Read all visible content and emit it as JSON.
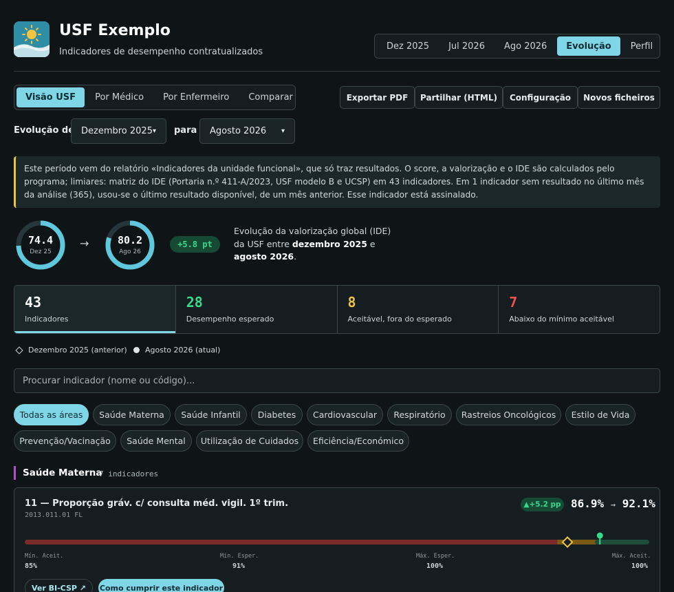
{
  "header": {
    "title": "USF Exemplo",
    "subtitle": "Indicadores de desempenho contratualizados",
    "logo_icon": "sun-landscape-icon",
    "period_tabs": [
      "Dez 2025",
      "Jul 2026",
      "Ago 2026",
      "Evolução",
      "Perfil"
    ],
    "active_period_tab": "Evolução"
  },
  "view_tabs": [
    "Visão USF",
    "Por Médico",
    "Por Enfermeiro",
    "Comparar"
  ],
  "active_view_tab": "Visão USF",
  "actions": {
    "export_pdf": "Exportar PDF",
    "share_html": "Partilhar (HTML)",
    "config": "Configuração",
    "new_files": "Novos ficheiros"
  },
  "evolution": {
    "from_label": "Evolução de",
    "from_value": "Dezembro 2025",
    "to_label": "para",
    "to_value": "Agosto 2026"
  },
  "notice": {
    "text": "Este período vem do relatório «Indicadores da unidade funcional», que só traz resultados. O score, a valorização e o IDE são calculados pelo programa; limiares: matriz do IDE (Portaria n.º 411-A/2023, USF modelo B e UCSP) em 43 indicadores. Em 1 indicador sem resultado no último mês da análise (365), usou-se o último resultado disponível, de um mês anterior. Esse indicador está assinalado.",
    "accent_color": "#e8c441"
  },
  "ide": {
    "before_value": "74.4",
    "before_fraction": 0.744,
    "before_label": "Dez 25",
    "after_value": "80.2",
    "after_fraction": 0.802,
    "after_label": "Ago 26",
    "arrow": "→",
    "delta": "+5.8 pt",
    "desc_prefix": "Evolução da valorização global (IDE) da USF entre ",
    "desc_from": "dezembro 2025",
    "desc_mid": " e ",
    "desc_to": "agosto 2026",
    "desc_suffix": "."
  },
  "stats": [
    {
      "value": "43",
      "label": "Indicadores",
      "color": "#ffffff"
    },
    {
      "value": "28",
      "label": "Desempenho esperado",
      "color": "#37d98c"
    },
    {
      "value": "8",
      "label": "Aceitável, fora do esperado",
      "color": "#e8c441"
    },
    {
      "value": "7",
      "label": "Abaixo do mínimo aceitável",
      "color": "#f0524f"
    }
  ],
  "legend": {
    "previous": "Dezembro 2025 (anterior)",
    "current": "Agosto 2026 (atual)"
  },
  "search": {
    "placeholder": "Procurar indicador (nome ou código)..."
  },
  "areas": [
    "Todas as áreas",
    "Saúde Materna",
    "Saúde Infantil",
    "Diabetes",
    "Cardiovascular",
    "Respiratório",
    "Rastreios Oncológicos",
    "Estilo de Vida",
    "Prevenção/Vacinação",
    "Saúde Mental",
    "Utilização de Cuidados",
    "Eficiência/Económico"
  ],
  "active_area": "Todas as áreas",
  "section": {
    "title": "Saúde Materna",
    "count": "7 indicadores",
    "accent_color": "#b04fc7"
  },
  "indicator": {
    "title": "11 — Proporção gráv. c/ consulta méd. vigil. 1º trim.",
    "code": "2013.011.01 FL",
    "delta": "▲+5.2 pp",
    "previous_value": "86.9%",
    "arrow": "→",
    "current_value": "92.1%",
    "previous": 86.9,
    "current": 92.1,
    "scale_min": 85,
    "scale_max": 100,
    "ranges": {
      "min_accept": 85,
      "min_expected": 91,
      "max_expected": 100,
      "max_accept": 100
    },
    "scale_labels": [
      "Mín. Aceit.",
      "Mín. Esper.",
      "Máx. Esper.",
      "Máx. Aceit."
    ],
    "scale_values": [
      "85%",
      "91%",
      "100%",
      "100%"
    ],
    "link_bicsp": "Ver BI-CSP ↗",
    "link_howto": "Como cumprir este indicador"
  }
}
